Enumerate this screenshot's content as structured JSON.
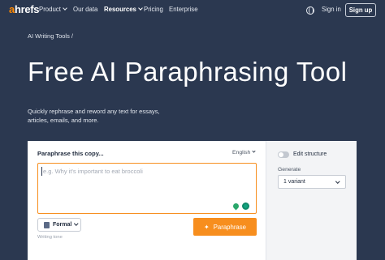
{
  "nav": {
    "logo_a": "a",
    "logo_rest": "hrefs",
    "items": [
      {
        "label": "Product",
        "dropdown": true
      },
      {
        "label": "Our data",
        "dropdown": false
      },
      {
        "label": "Resources",
        "dropdown": true,
        "active": true
      },
      {
        "label": "Pricing",
        "dropdown": false
      },
      {
        "label": "Enterprise",
        "dropdown": false
      }
    ],
    "globe_icon": "globe-icon",
    "signin_label": "Sign in",
    "signup_label": "Sign up"
  },
  "breadcrumb": "AI Writing Tools /",
  "hero": {
    "title": "Free AI Paraphrasing Tool",
    "subtitle": "Quickly rephrase and reword any text for essays, articles, emails, and more."
  },
  "tool": {
    "input_label": "Paraphrase this copy...",
    "language": "English",
    "placeholder": "e.g. Why it's important to eat broccoli",
    "tone_value": "Formal",
    "tone_caption": "Writing tone",
    "paraphrase_label": "Paraphrase",
    "edit_structure_label": "Edit structure",
    "generate_label": "Generate",
    "variant_value": "1 variant"
  },
  "colors": {
    "background": "#2b3850",
    "accent": "#f78e1e",
    "logo_accent": "#ff8800"
  }
}
